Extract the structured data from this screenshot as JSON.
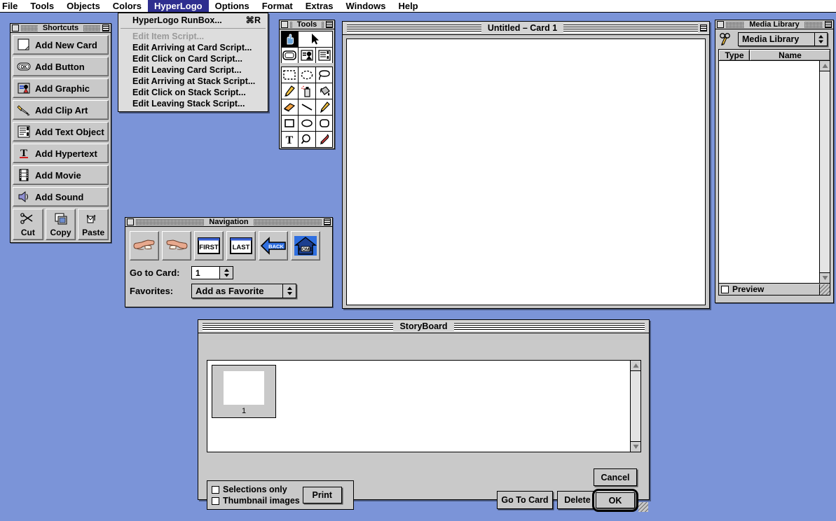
{
  "menubar": {
    "items": [
      {
        "label": "File",
        "active": false,
        "clipped": true
      },
      {
        "label": "Tools",
        "active": false
      },
      {
        "label": "Objects",
        "active": false
      },
      {
        "label": "Colors",
        "active": false
      },
      {
        "label": "HyperLogo",
        "active": true
      },
      {
        "label": "Options",
        "active": false
      },
      {
        "label": "Format",
        "active": false
      },
      {
        "label": "Extras",
        "active": false
      },
      {
        "label": "Windows",
        "active": false
      },
      {
        "label": "Help",
        "active": false
      }
    ],
    "highlight_color": "#2e2e8f"
  },
  "dropdown": {
    "open_for": "HyperLogo",
    "items": [
      {
        "label": "HyperLogo RunBox...",
        "shortcut": "⌘R",
        "disabled": false
      },
      {
        "label": "Edit Item Script...",
        "shortcut": "",
        "disabled": true
      },
      {
        "label": "Edit Arriving at Card Script...",
        "shortcut": "",
        "disabled": false
      },
      {
        "label": "Edit Click on Card Script...",
        "shortcut": "",
        "disabled": false
      },
      {
        "label": "Edit  Leaving Card Script...",
        "shortcut": "",
        "disabled": false
      },
      {
        "label": "Edit Arriving at Stack Script...",
        "shortcut": "",
        "disabled": false
      },
      {
        "label": "Edit Click on Stack Script...",
        "shortcut": "",
        "disabled": false
      },
      {
        "label": "Edit  Leaving Stack Script...",
        "shortcut": "",
        "disabled": false
      }
    ]
  },
  "shortcuts_palette": {
    "title": "Shortcuts",
    "buttons": [
      {
        "label": "Add New Card",
        "icon": "new-card-icon"
      },
      {
        "label": "Add Button",
        "icon": "ok-button-icon"
      },
      {
        "label": "Add Graphic",
        "icon": "graphic-icon"
      },
      {
        "label": "Add Clip Art",
        "icon": "clip-art-icon"
      },
      {
        "label": "Add Text Object",
        "icon": "text-object-icon"
      },
      {
        "label": "Add Hypertext",
        "icon": "hypertext-icon"
      },
      {
        "label": "Add Movie",
        "icon": "movie-film-icon"
      },
      {
        "label": "Add Sound",
        "icon": "speaker-icon"
      }
    ],
    "edit_buttons": [
      {
        "label": "Cut",
        "icon": "scissors-icon"
      },
      {
        "label": "Copy",
        "icon": "copy-icon"
      },
      {
        "label": "Paste",
        "icon": "paste-icon"
      }
    ]
  },
  "tools_palette": {
    "title": "Tools",
    "tools": [
      {
        "name": "browse-hand-tool",
        "selected": true
      },
      {
        "name": "arrow-pointer-tool",
        "selected": false
      },
      {
        "name": "button-tool",
        "selected": false
      },
      {
        "name": "graphic-object-tool",
        "selected": false
      },
      {
        "name": "text-object-tool",
        "selected": false
      },
      {
        "name": "rect-select-tool",
        "selected": false
      },
      {
        "name": "oval-select-tool",
        "selected": false
      },
      {
        "name": "lasso-tool",
        "selected": false
      },
      {
        "name": "paintbrush-tool",
        "selected": false
      },
      {
        "name": "spray-can-tool",
        "selected": false
      },
      {
        "name": "paint-bucket-tool",
        "selected": false
      },
      {
        "name": "eraser-tool",
        "selected": false
      },
      {
        "name": "line-tool",
        "selected": false
      },
      {
        "name": "pencil-tool",
        "selected": false
      },
      {
        "name": "rectangle-tool",
        "selected": false
      },
      {
        "name": "oval-tool",
        "selected": false
      },
      {
        "name": "rounded-rect-tool",
        "selected": false
      },
      {
        "name": "text-tool",
        "selected": false
      },
      {
        "name": "magnifier-tool",
        "selected": false
      },
      {
        "name": "eyedropper-tool",
        "selected": false
      }
    ]
  },
  "navigation_palette": {
    "title": "Navigation",
    "buttons": [
      {
        "name": "previous-card-button",
        "icon": "hand-point-left-icon",
        "label": ""
      },
      {
        "name": "next-card-button",
        "icon": "hand-point-right-icon",
        "label": ""
      },
      {
        "name": "first-card-button",
        "icon": "first-icon",
        "label": "FIRST"
      },
      {
        "name": "last-card-button",
        "icon": "last-icon",
        "label": "LAST"
      },
      {
        "name": "back-button",
        "icon": "back-arrow-icon",
        "label": "BACK"
      },
      {
        "name": "home-button",
        "icon": "home-house-icon",
        "label": "HOME"
      }
    ],
    "go_to_card": {
      "label": "Go to Card:",
      "value": "1"
    },
    "favorites": {
      "label": "Favorites:",
      "value": "Add as Favorite"
    }
  },
  "card_window": {
    "title": "Untitled – Card 1"
  },
  "media_library": {
    "title": "Media Library",
    "selector_value": "Media Library",
    "columns": [
      "Type",
      "Name"
    ],
    "rows": [],
    "preview_label": "Preview",
    "preview_checked": false
  },
  "storyboard": {
    "title": "StoryBoard",
    "thumbnails": [
      {
        "number": "1"
      }
    ],
    "checkboxes": [
      {
        "label": "Selections only",
        "checked": false
      },
      {
        "label": "Thumbnail images",
        "checked": false
      }
    ],
    "print_button": "Print",
    "buttons": [
      {
        "label": "Cancel",
        "name": "cancel-button",
        "default": false
      },
      {
        "label": "Go To Card",
        "name": "go-to-card-button",
        "default": false
      },
      {
        "label": "Delete",
        "name": "delete-button",
        "default": false
      },
      {
        "label": "OK",
        "name": "ok-button",
        "default": true
      }
    ]
  },
  "desktop": {
    "background_color": "#7b94d8"
  }
}
